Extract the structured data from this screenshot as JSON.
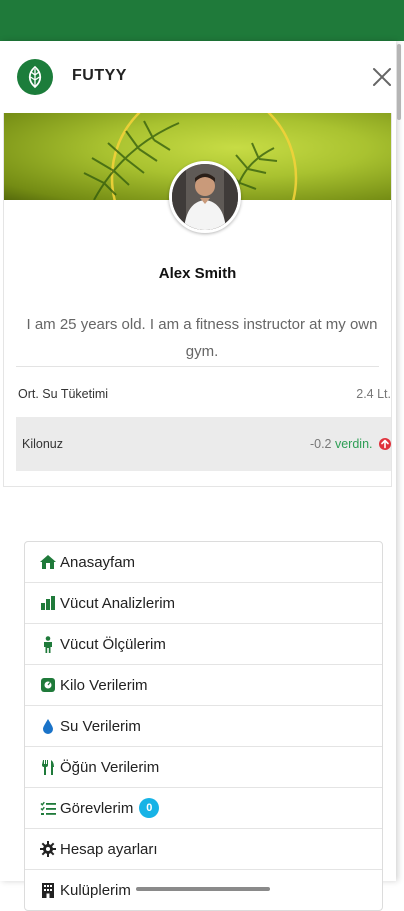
{
  "app": {
    "brand": "FUTYY"
  },
  "profile": {
    "name": "Alex Smith",
    "bio": "I am 25 years old. I am a fitness instructor at my own gym."
  },
  "stats": {
    "water": {
      "label": "Ort. Su Tüketimi",
      "value": "2.4 Lt."
    },
    "weight": {
      "label": "Kilonuz",
      "value": "-0.2",
      "status": "verdin."
    }
  },
  "menu": {
    "items": [
      {
        "label": "Anasayfam",
        "icon": "home-icon"
      },
      {
        "label": "Vücut Analizlerim",
        "icon": "bar-chart-icon"
      },
      {
        "label": "Vücut Ölçülerim",
        "icon": "person-icon"
      },
      {
        "label": "Kilo Verilerim",
        "icon": "scale-icon"
      },
      {
        "label": "Su Verilerim",
        "icon": "water-drop-icon"
      },
      {
        "label": "Öğün Verilerim",
        "icon": "utensils-icon"
      },
      {
        "label": "Görevlerim",
        "icon": "task-list-icon",
        "badge": "0"
      },
      {
        "label": "Hesap ayarları",
        "icon": "gear-icon"
      },
      {
        "label": "Kulüplerim",
        "icon": "building-icon"
      }
    ]
  },
  "colors": {
    "primary_green": "#1f7a3a",
    "accent_green": "#2e9e55",
    "alert_red": "#e0323c",
    "badge_blue": "#17b3e6"
  }
}
